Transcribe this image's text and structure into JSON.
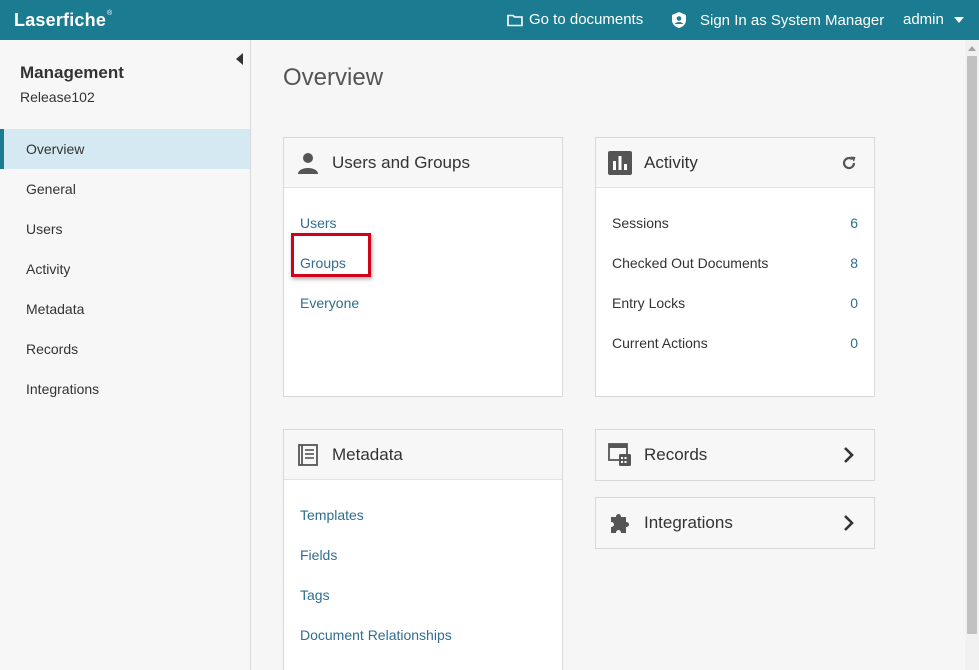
{
  "header": {
    "logo": "Laserfiche",
    "logo_mark": "®",
    "go_to_documents": "Go to documents",
    "sign_in_system_manager": "Sign In as System Manager",
    "user": "admin",
    "bar_color": "#1b7c91"
  },
  "sidebar": {
    "title": "Management",
    "subtitle": "Release102",
    "items": [
      {
        "label": "Overview",
        "active": true
      },
      {
        "label": "General"
      },
      {
        "label": "Users"
      },
      {
        "label": "Activity"
      },
      {
        "label": "Metadata"
      },
      {
        "label": "Records"
      },
      {
        "label": "Integrations"
      }
    ]
  },
  "main": {
    "title": "Overview",
    "users_groups": {
      "title": "Users and Groups",
      "icon": "user-icon",
      "links": [
        "Users",
        "Groups",
        "Everyone"
      ]
    },
    "activity": {
      "title": "Activity",
      "icon": "bar-chart-icon",
      "refresh_icon": "refresh-icon",
      "rows": [
        {
          "label": "Sessions",
          "value": "6"
        },
        {
          "label": "Checked Out Documents",
          "value": "8"
        },
        {
          "label": "Entry Locks",
          "value": "0"
        },
        {
          "label": "Current Actions",
          "value": "0"
        }
      ]
    },
    "metadata": {
      "title": "Metadata",
      "icon": "list-icon",
      "links": [
        "Templates",
        "Fields",
        "Tags",
        "Document Relationships"
      ]
    },
    "records": {
      "title": "Records",
      "icon": "records-icon"
    },
    "integrations": {
      "title": "Integrations",
      "icon": "puzzle-icon"
    }
  },
  "colors": {
    "accent": "#1b7c91",
    "link": "#2f6e8e",
    "active_nav": "#d4e9f2",
    "highlight": "#d0021b"
  }
}
